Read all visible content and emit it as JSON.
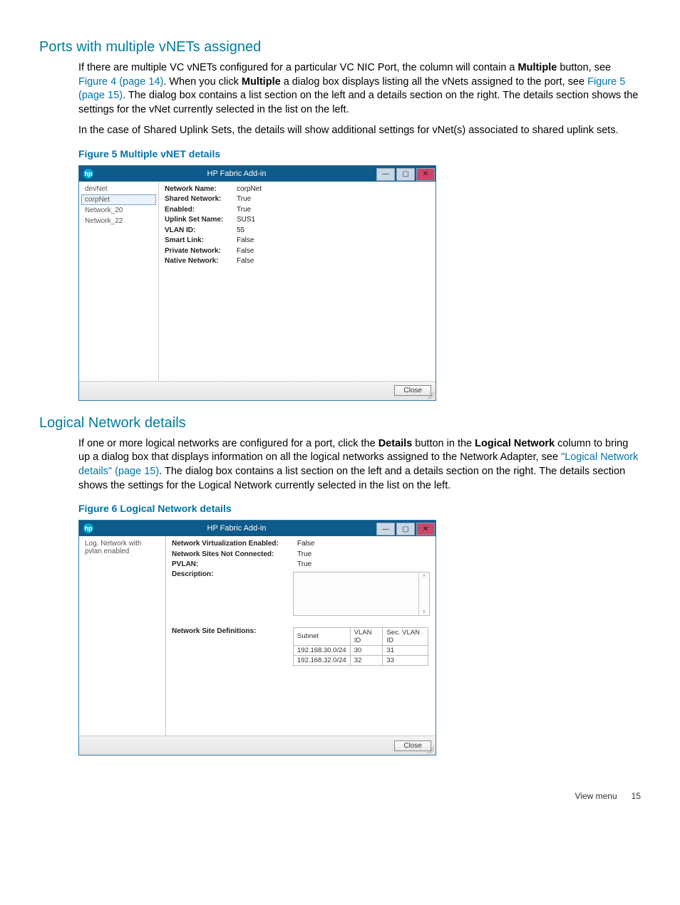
{
  "sec1": {
    "heading": "Ports with multiple vNETs assigned",
    "p1_a": "If there are multiple VC vNETs configured for a particular VC NIC Port, the column will contain a ",
    "p1_b": "Multiple",
    "p1_c": " button, see ",
    "p1_link1": "Figure 4 (page 14)",
    "p1_d": ". When you click ",
    "p1_e": "Multiple",
    "p1_f": " a dialog box displays listing all the vNets assigned to the port, see ",
    "p1_link2": "Figure 5 (page 15)",
    "p1_g": ". The dialog box contains a list section on the left and a details section on the right. The details section shows the settings for the vNet currently selected in the list on the left.",
    "p2": "In the case of Shared Uplink Sets, the details will show additional settings for vNet(s) associated to shared uplink sets.",
    "figcap": "Figure 5 Multiple vNET details"
  },
  "fig5": {
    "title": "HP Fabric Add-in",
    "list": [
      "devNet",
      "corpNet",
      "Network_20",
      "Network_22"
    ],
    "selected_index": 1,
    "details": [
      {
        "k": "Network Name:",
        "v": "corpNet"
      },
      {
        "k": "Shared Network:",
        "v": "True"
      },
      {
        "k": "Enabled:",
        "v": "True"
      },
      {
        "k": "Uplink Set Name:",
        "v": "SUS1"
      },
      {
        "k": "VLAN ID:",
        "v": "55"
      },
      {
        "k": "Smart Link:",
        "v": "False"
      },
      {
        "k": "Private Network:",
        "v": "False"
      },
      {
        "k": "Native Network:",
        "v": "False"
      }
    ],
    "close": "Close"
  },
  "sec2": {
    "heading": "Logical Network details",
    "p1_a": "If one or more logical networks are configured for a port, click the ",
    "p1_b": "Details",
    "p1_c": " button in the ",
    "p1_d": "Logical Network",
    "p1_e": " column to bring up a dialog box that displays information on all the logical networks assigned to the Network Adapter, see ",
    "p1_link": "\"Logical Network details\" (page 15)",
    "p1_f": ". The dialog box contains a list section on the left and a details section on the right. The details section shows the settings for the Logical Network currently selected in the list on the left.",
    "figcap": "Figure 6 Logical Network details"
  },
  "fig6": {
    "title": "HP Fabric Add-in",
    "list": [
      "Log. Network with pvlan enabled"
    ],
    "details": [
      {
        "k": "Network Virtualization Enabled:",
        "v": "False"
      },
      {
        "k": "Network Sites Not Connected:",
        "v": "True"
      },
      {
        "k": "PVLAN:",
        "v": "True"
      },
      {
        "k": "Description:",
        "v": ""
      }
    ],
    "nsd_label": "Network Site Definitions:",
    "table": {
      "headers": [
        "Subnet",
        "VLAN ID",
        "Sec. VLAN ID"
      ],
      "rows": [
        [
          "192.168.30.0/24",
          "30",
          "31"
        ],
        [
          "192.168.32.0/24",
          "32",
          "33"
        ]
      ]
    },
    "close": "Close"
  },
  "footer": {
    "section": "View menu",
    "page": "15"
  }
}
